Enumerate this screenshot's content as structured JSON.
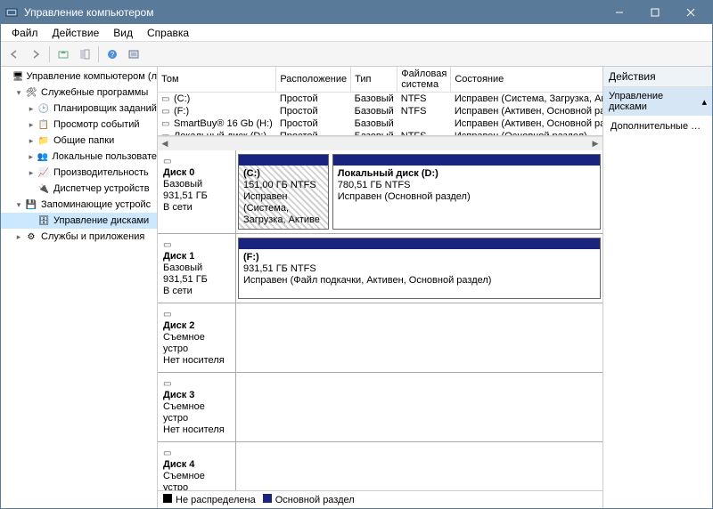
{
  "window": {
    "title": "Управление компьютером"
  },
  "menu": {
    "file": "Файл",
    "action": "Действие",
    "view": "Вид",
    "help": "Справка"
  },
  "tree": {
    "root": "Управление компьютером (л",
    "sysTools": "Служебные программы",
    "taskScheduler": "Планировщик заданий",
    "eventViewer": "Просмотр событий",
    "sharedFolders": "Общие папки",
    "localUsers": "Локальные пользовате",
    "performance": "Производительность",
    "deviceMgr": "Диспетчер устройств",
    "storage": "Запоминающие устройс",
    "diskMgmt": "Управление дисками",
    "services": "Службы и приложения"
  },
  "columns": {
    "volume": "Том",
    "layout": "Расположение",
    "type": "Тип",
    "fs": "Файловая система",
    "status": "Состояние"
  },
  "volumes": [
    {
      "icon": "drive",
      "name": "(C:)",
      "layout": "Простой",
      "type": "Базовый",
      "fs": "NTFS",
      "status": "Исправен (Система, Загрузка, Ак"
    },
    {
      "icon": "drive",
      "name": "(F:)",
      "layout": "Простой",
      "type": "Базовый",
      "fs": "NTFS",
      "status": "Исправен (Активен, Основной ра"
    },
    {
      "icon": "drive",
      "name": "SmartBuy® 16 Gb (H:)",
      "layout": "Простой",
      "type": "Базовый",
      "fs": "",
      "status": "Исправен (Активен, Основной ра"
    },
    {
      "icon": "drive",
      "name": "Локальный диск (D:)",
      "layout": "Простой",
      "type": "Базовый",
      "fs": "NTFS",
      "status": "Исправен (Основной раздел)"
    }
  ],
  "disks": [
    {
      "name": "Диск 0",
      "kind": "Базовый",
      "size": "931,51 ГБ",
      "state": "В сети",
      "parts": [
        {
          "title": "(C:)",
          "cap": "151,00 ГБ NTFS",
          "status": "Исправен (Система, Загрузка, Активе",
          "flex": 1,
          "hatched": true
        },
        {
          "title": "Локальный диск  (D:)",
          "cap": "780,51 ГБ NTFS",
          "status": "Исправен (Основной раздел)",
          "flex": 3,
          "hatched": false
        }
      ]
    },
    {
      "name": "Диск 1",
      "kind": "Базовый",
      "size": "931,51 ГБ",
      "state": "В сети",
      "parts": [
        {
          "title": "(F:)",
          "cap": "931,51 ГБ NTFS",
          "status": "Исправен (Файл подкачки, Активен, Основной раздел)",
          "flex": 1,
          "hatched": false
        }
      ]
    },
    {
      "name": "Диск 2",
      "kind": "Съемное устро",
      "size": "",
      "state": "Нет носителя",
      "parts": []
    },
    {
      "name": "Диск 3",
      "kind": "Съемное устро",
      "size": "",
      "state": "Нет носителя",
      "parts": []
    },
    {
      "name": "Диск 4",
      "kind": "Съемное устро",
      "size": "",
      "state": "",
      "parts": []
    }
  ],
  "legend": {
    "unalloc": "Не распределена",
    "primary": "Основной раздел"
  },
  "actions": {
    "header": "Действия",
    "group": "Управление дисками",
    "more": "Дополнительные дей..."
  }
}
